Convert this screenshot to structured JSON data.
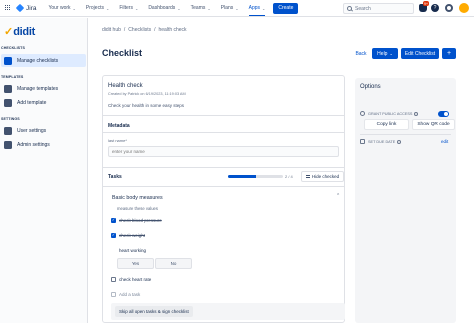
{
  "topnav": {
    "app_name": "Jira",
    "items": [
      "Your work",
      "Projects",
      "Filters",
      "Dashboards",
      "Teams",
      "Plans",
      "Apps"
    ],
    "create_label": "Create",
    "search_placeholder": "Search",
    "notification_badge": "9+"
  },
  "sidebar": {
    "logo_text": "didit",
    "sections": [
      {
        "title": "CHECKLISTS",
        "items": [
          "Manage checklists"
        ]
      },
      {
        "title": "TEMPLATES",
        "items": [
          "Manage templates",
          "Add template"
        ]
      },
      {
        "title": "SETTINGS",
        "items": [
          "User settings",
          "Admin settings"
        ]
      }
    ],
    "active_item": "Manage checklists"
  },
  "breadcrumb": [
    "didit hub",
    "/",
    "Checklists",
    "/",
    "health check"
  ],
  "page_title": "Checklist",
  "header_buttons": {
    "back": "Back",
    "help": "Help",
    "edit": "Edit Checklist",
    "more": "+"
  },
  "checklist": {
    "title": "Health check",
    "meta": "Created by Patrick on 6/19/2023, 11:19:03 AM",
    "description": "Check your health in some easy steps",
    "metadata_label": "Metadata",
    "field_label": "last name*",
    "field_placeholder": "enter your name",
    "tasks_label": "Tasks",
    "progress_fraction": 0.5,
    "progress_text": "2 / 4",
    "hide_checked_label": "Hide checked",
    "group_title": "Basic body measures",
    "group_subtitle": "measure these values",
    "tasks": [
      {
        "label": "check blood pressure",
        "state": "checked"
      },
      {
        "label": "check weight",
        "state": "checked"
      },
      {
        "label": "heart working",
        "state": "question"
      },
      {
        "label": "check heart rate",
        "state": "unchecked"
      },
      {
        "label": "Add a task",
        "state": "add"
      }
    ],
    "answer_yes": "Yes",
    "answer_no": "No",
    "skip_button": "Skip all open tasks & sign checklist"
  },
  "options": {
    "title": "Options",
    "public_access_label": "GRANT PUBLIC ACCESS",
    "public_access_enabled": true,
    "copy_link": "Copy link",
    "show_qr": "Show QR code",
    "due_date_label": "SET DUE DATE",
    "edit_label": "edit"
  }
}
